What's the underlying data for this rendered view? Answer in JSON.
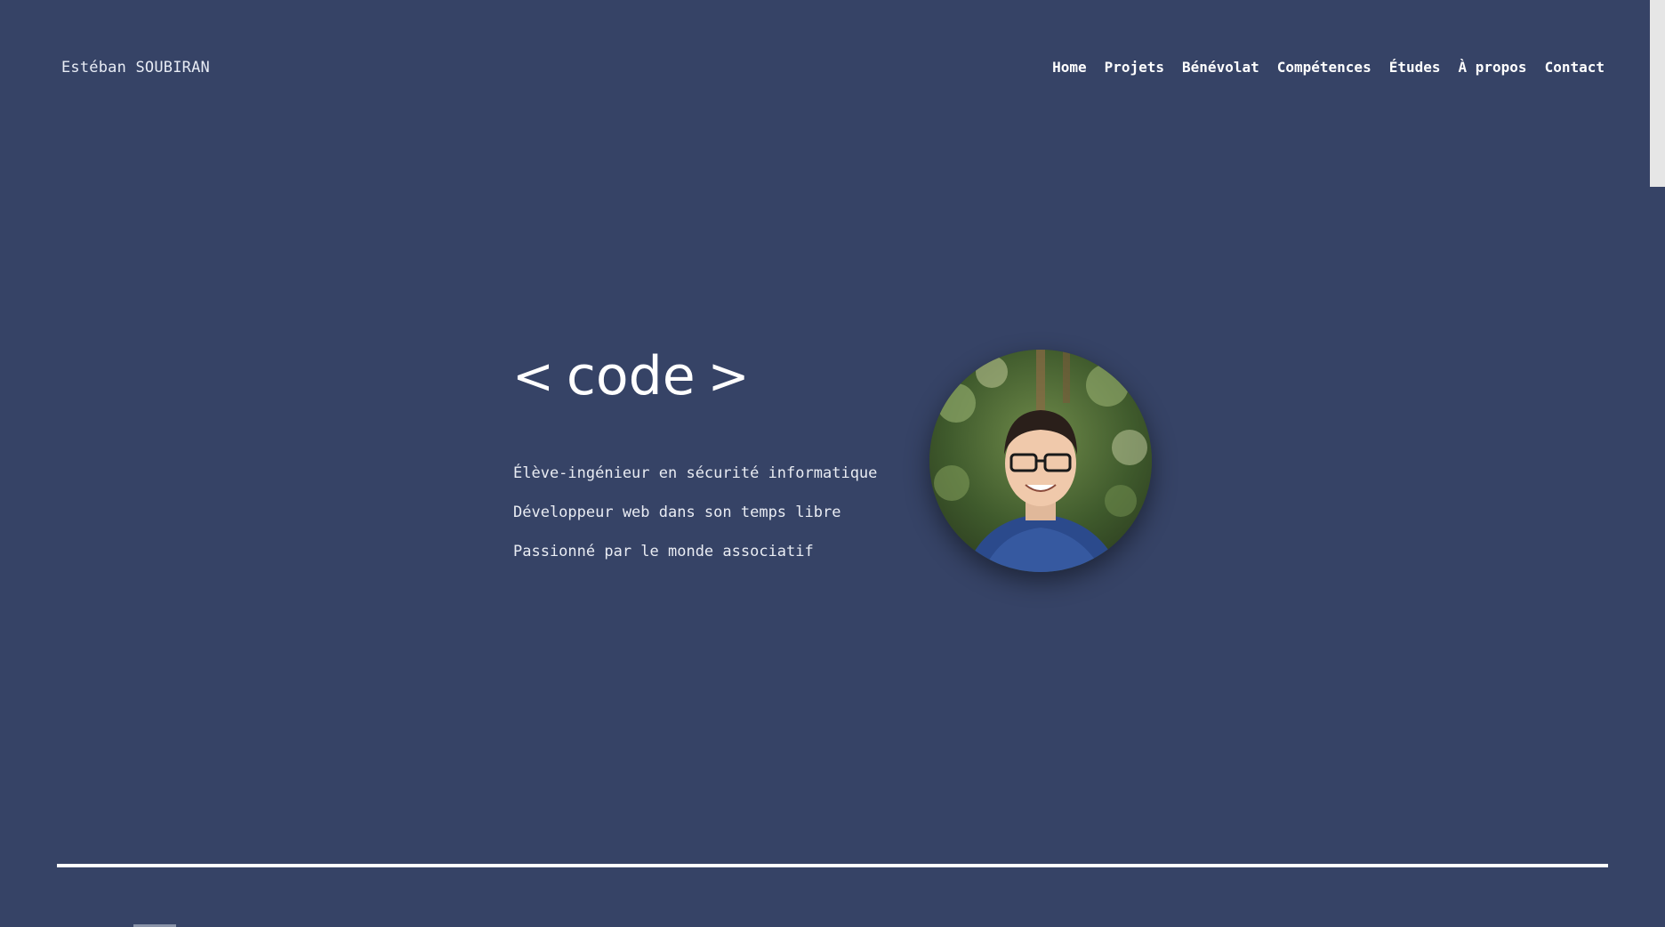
{
  "header": {
    "brand": "Estéban SOUBIRAN",
    "nav": [
      {
        "label": "Home"
      },
      {
        "label": "Projets"
      },
      {
        "label": "Bénévolat"
      },
      {
        "label": "Compétences"
      },
      {
        "label": "Études"
      },
      {
        "label": "À propos"
      },
      {
        "label": "Contact"
      }
    ]
  },
  "hero": {
    "bracket_open": "<",
    "word": "code",
    "bracket_close": ">",
    "taglines": [
      "Élève-ingénieur en sécurité informatique",
      "Développeur web dans son temps libre",
      "Passionné par le monde associatif"
    ],
    "avatar_icon": "profile-photo"
  },
  "colors": {
    "background": "#364366",
    "text": "#ffffff",
    "rule": "#ffffff"
  }
}
